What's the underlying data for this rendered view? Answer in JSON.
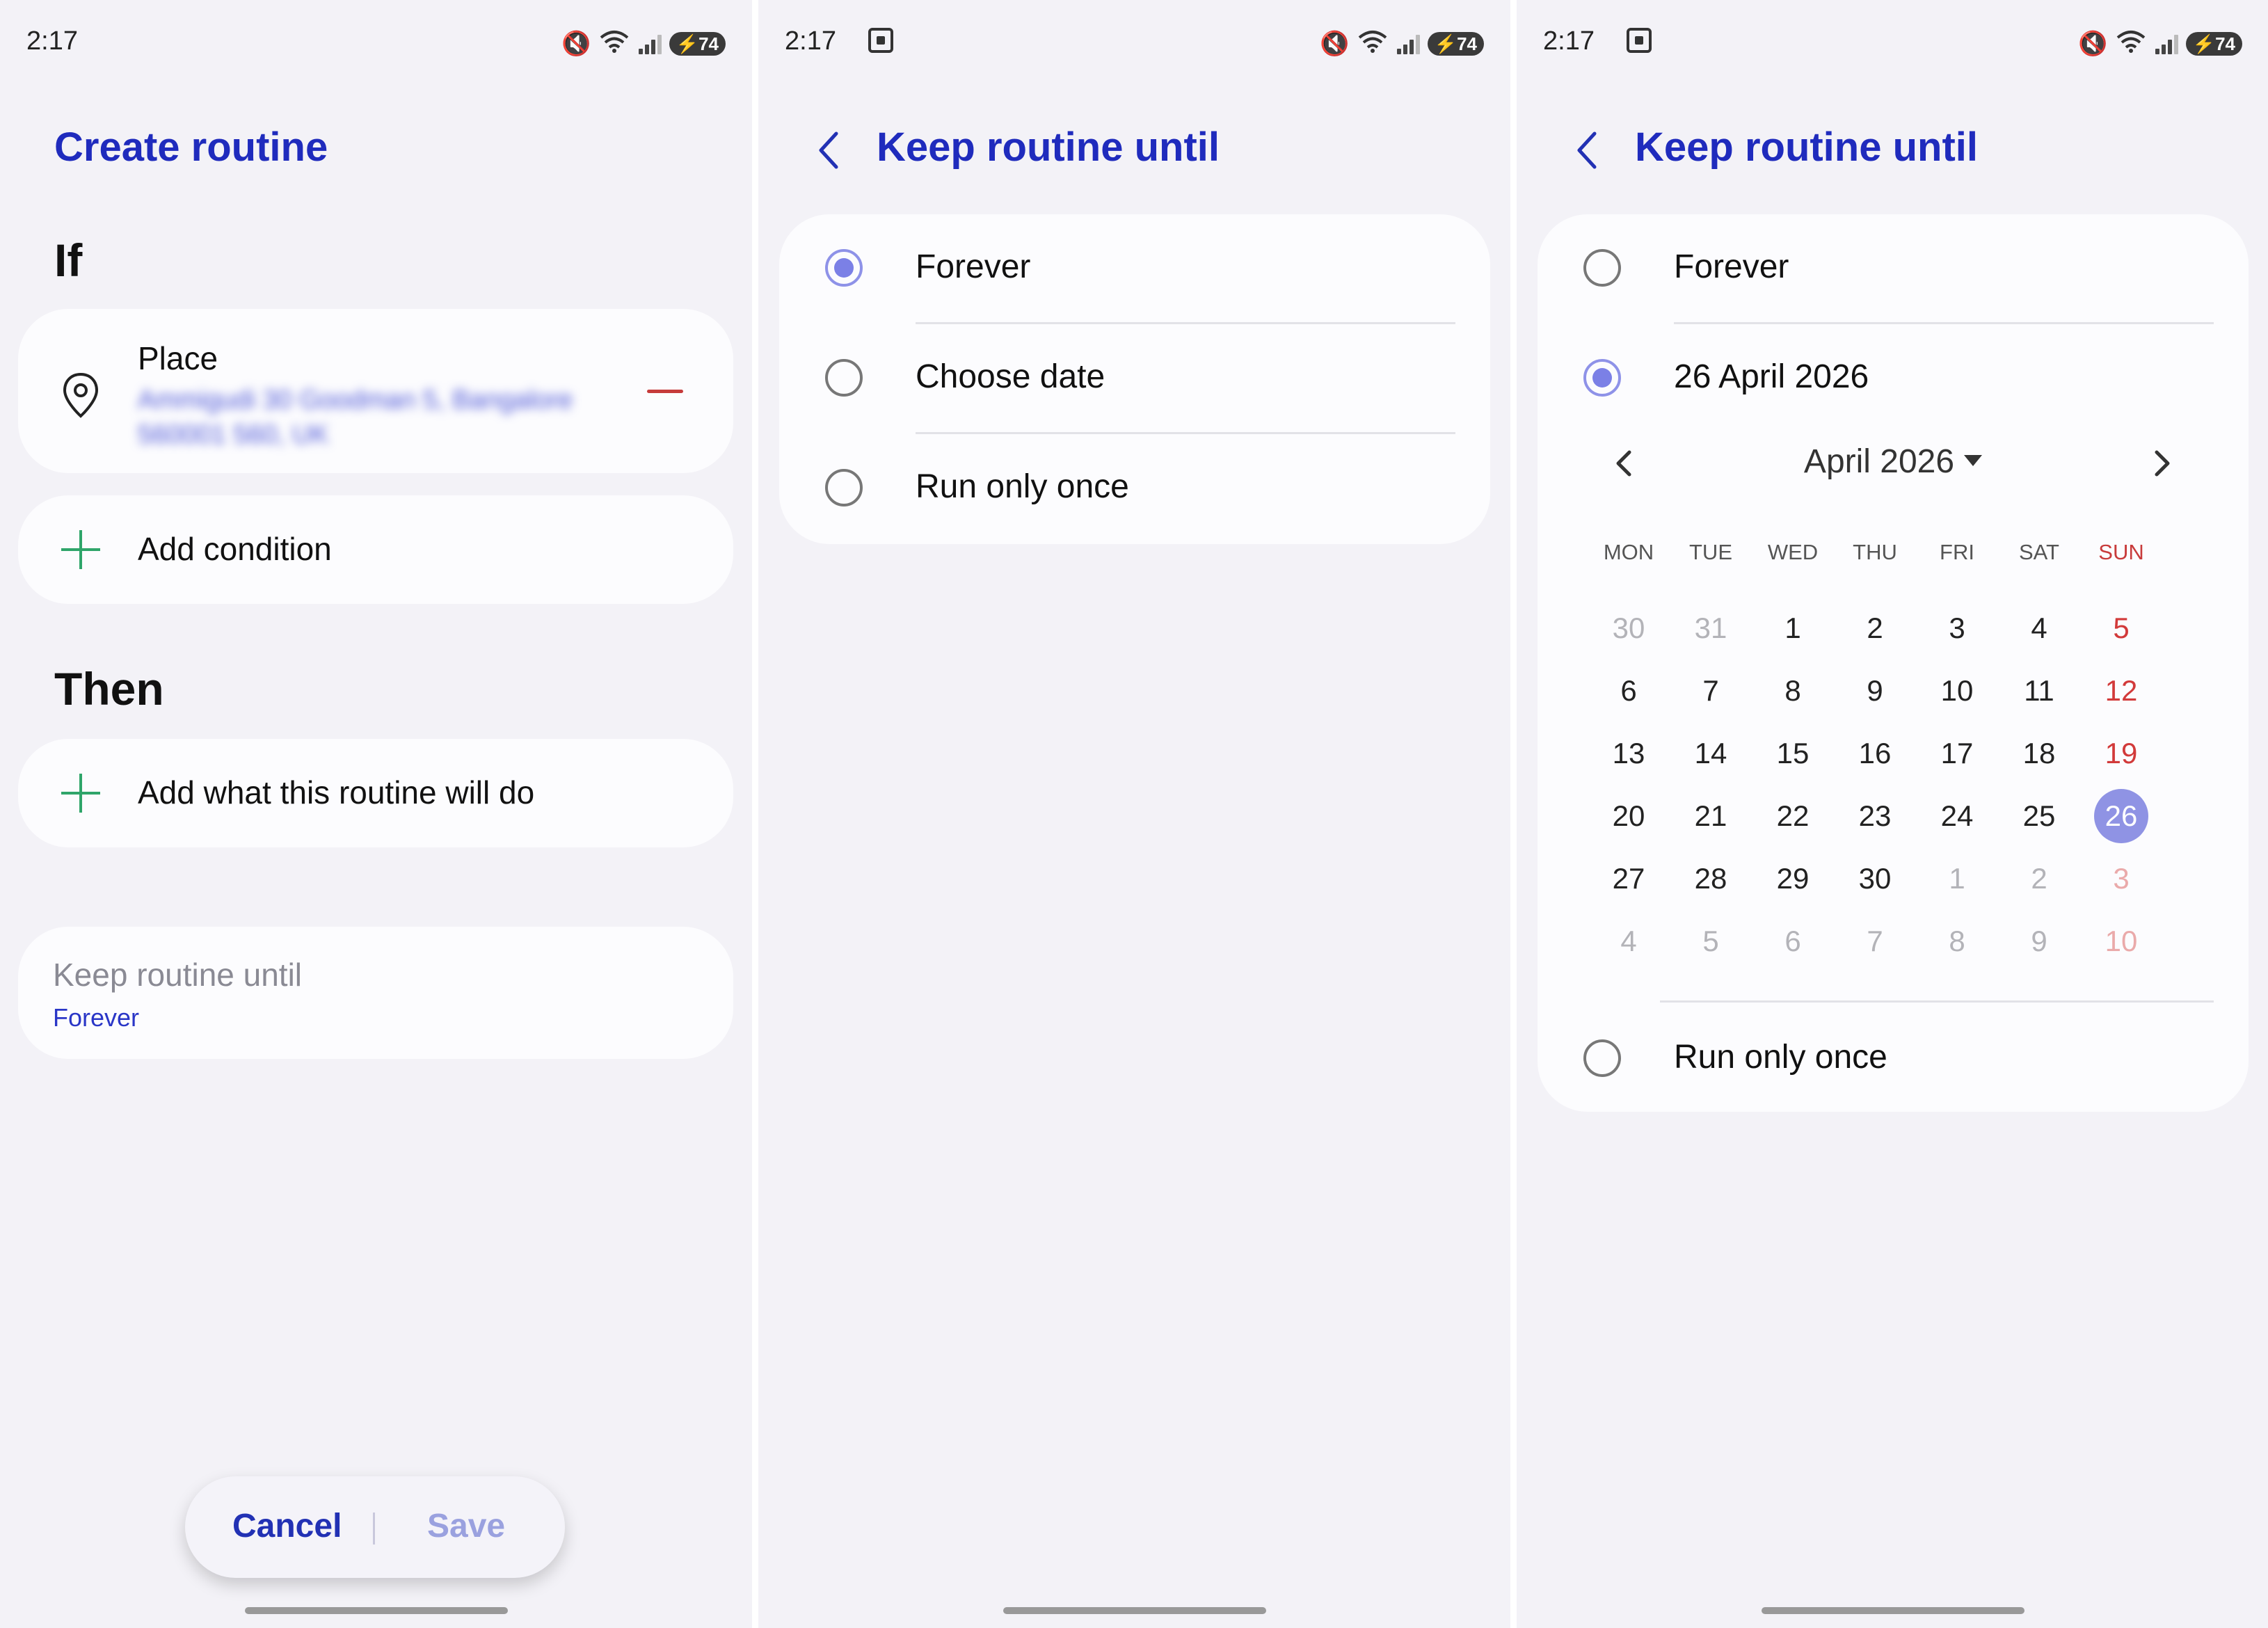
{
  "status": {
    "time": "2:17",
    "battery": "74"
  },
  "screen1": {
    "title": "Create routine",
    "if_label": "If",
    "place_label": "Place",
    "place_address": "Ammigudi 30 Goodman 5, Bangalore 560001 560, UK",
    "add_condition": "Add condition",
    "then_label": "Then",
    "add_action": "Add what this routine will do",
    "keep_title": "Keep routine until",
    "keep_value": "Forever",
    "cancel": "Cancel",
    "save": "Save"
  },
  "screen2": {
    "title": "Keep routine until",
    "options": [
      "Forever",
      "Choose date",
      "Run only once"
    ],
    "selected": 0
  },
  "screen3": {
    "title": "Keep routine until",
    "option_forever": "Forever",
    "option_date": "26 April 2026",
    "option_once": "Run only once",
    "month": "April 2026",
    "weekdays": [
      "MON",
      "TUE",
      "WED",
      "THU",
      "FRI",
      "SAT",
      "SUN"
    ],
    "weeks": [
      [
        "30",
        "31",
        "1",
        "2",
        "3",
        "4",
        "5"
      ],
      [
        "6",
        "7",
        "8",
        "9",
        "10",
        "11",
        "12"
      ],
      [
        "13",
        "14",
        "15",
        "16",
        "17",
        "18",
        "19"
      ],
      [
        "20",
        "21",
        "22",
        "23",
        "24",
        "25",
        "26"
      ],
      [
        "27",
        "28",
        "29",
        "30",
        "1",
        "2",
        "3"
      ],
      [
        "4",
        "5",
        "6",
        "7",
        "8",
        "9",
        "10"
      ]
    ],
    "selected_day": "26"
  },
  "colors": {
    "accent": "#1f2bbd",
    "radio_selected": "#7b80e6",
    "sunday": "#d23a3a",
    "add_icon": "#2fa56a",
    "remove_icon": "#c63b3b"
  },
  "icons": {
    "location": "location-pin-icon",
    "add": "plus-icon",
    "remove": "minus-icon",
    "back": "chevron-left-icon",
    "prev_month": "chevron-left-icon",
    "next_month": "chevron-right-icon",
    "dropdown": "triangle-down-icon"
  }
}
